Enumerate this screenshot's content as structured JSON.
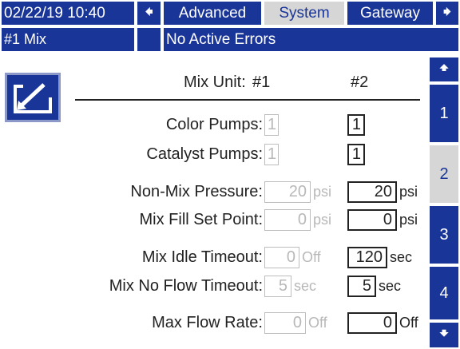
{
  "header": {
    "datetime": "02/22/19 10:40",
    "tabs": [
      {
        "label": "Advanced"
      },
      {
        "label": "System"
      },
      {
        "label": "Gateway"
      }
    ],
    "mix_name": "#1 Mix",
    "status": "No Active Errors"
  },
  "side_nav": {
    "pages": [
      "1",
      "2",
      "3",
      "4"
    ],
    "selected": "2"
  },
  "table": {
    "header_label": "Mix Unit:",
    "col1": "#1",
    "col2": "#2",
    "rows": [
      {
        "label": "Color Pumps:",
        "v1": "1",
        "u1": "",
        "v2": "1",
        "u2": ""
      },
      {
        "label": "Catalyst Pumps:",
        "v1": "1",
        "u1": "",
        "v2": "1",
        "u2": ""
      },
      {
        "label": "Non-Mix Pressure:",
        "v1": "20",
        "u1": "psi",
        "v2": "20",
        "u2": "psi"
      },
      {
        "label": "Mix Fill Set Point:",
        "v1": "0",
        "u1": "psi",
        "v2": "0",
        "u2": "psi"
      },
      {
        "label": "Mix Idle Timeout:",
        "v1": "0",
        "u1": "Off",
        "v2": "120",
        "u2": "sec"
      },
      {
        "label": "Mix No Flow Timeout:",
        "v1": "5",
        "u1": "sec",
        "v2": "5",
        "u2": "sec"
      },
      {
        "label": "Max Flow Rate:",
        "v1": "0",
        "u1": "Off",
        "v2": "0",
        "u2": "Off"
      }
    ]
  },
  "icons": {
    "nav_left": "arrow-left-icon",
    "nav_right": "arrow-right-icon",
    "scroll_up": "arrow-up-icon",
    "scroll_down": "arrow-down-icon",
    "edit": "edit-icon"
  },
  "colors": {
    "accent_blue": "#1a3598",
    "selected_tab": "#d6d6d6"
  }
}
